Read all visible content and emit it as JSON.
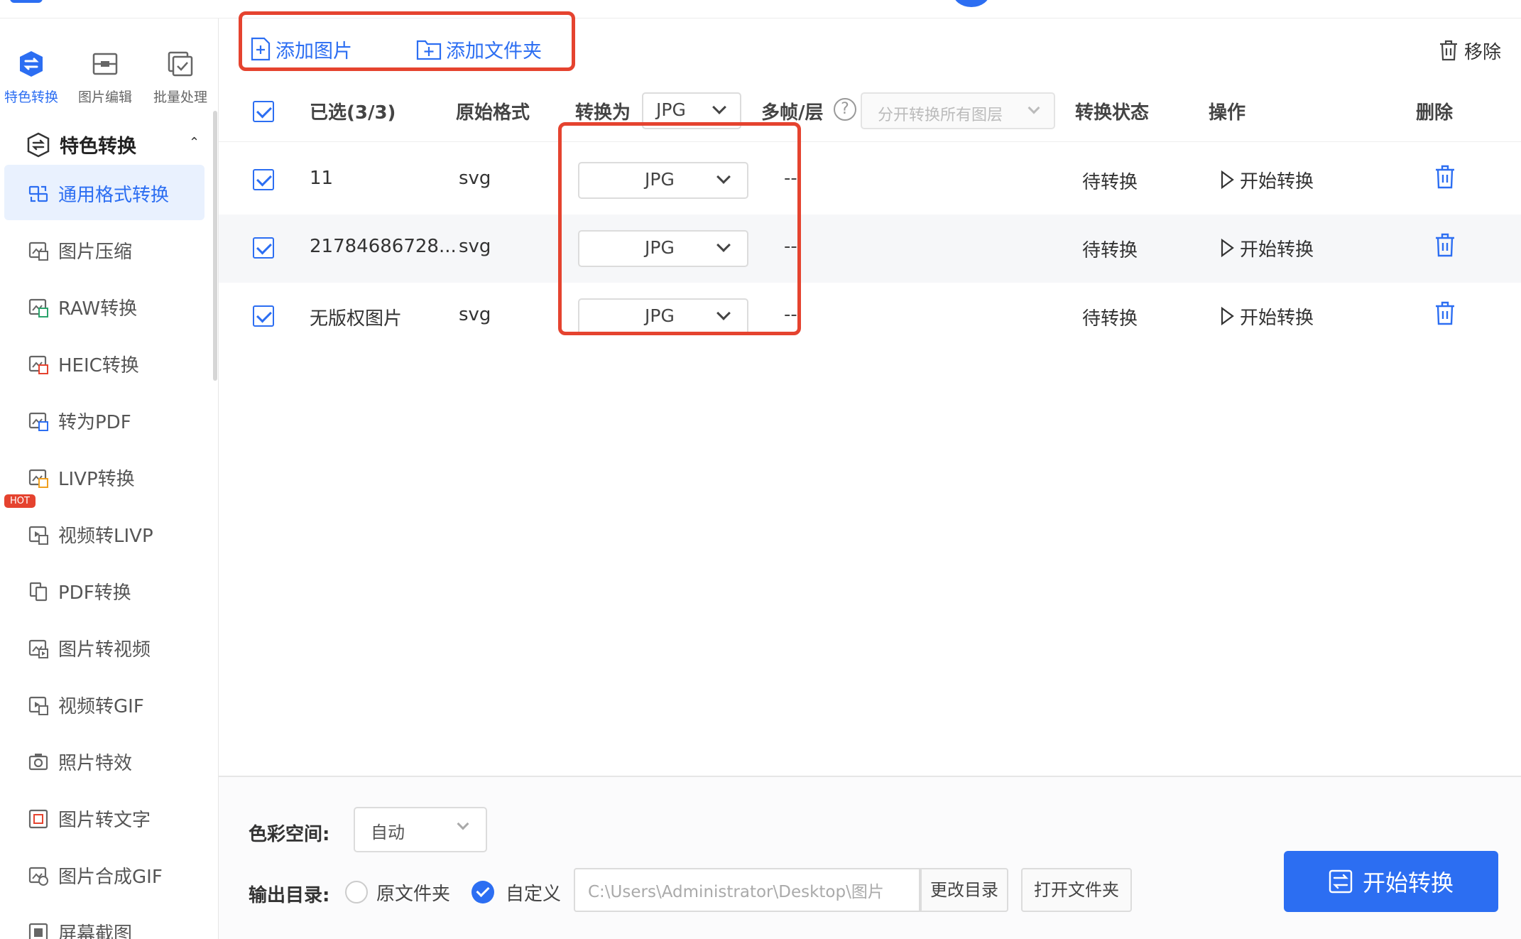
{
  "colors": {
    "accent": "#2c6ef2",
    "highlight_box": "#e5432f",
    "hot_badge": "#e5432f"
  },
  "sidebar": {
    "top_tabs": [
      {
        "label": "特色转换",
        "icon": "convert-shield-icon",
        "active": true
      },
      {
        "label": "图片编辑",
        "icon": "image-edit-icon",
        "active": false
      },
      {
        "label": "批量处理",
        "icon": "batch-check-icon",
        "active": false
      }
    ],
    "group_title": "特色转换",
    "items": [
      {
        "label": "通用格式转换",
        "active": true
      },
      {
        "label": "图片压缩"
      },
      {
        "label": "RAW转换"
      },
      {
        "label": "HEIC转换"
      },
      {
        "label": "转为PDF"
      },
      {
        "label": "LIVP转换"
      },
      {
        "label": "视频转LIVP",
        "badge": "HOT"
      },
      {
        "label": "PDF转换"
      },
      {
        "label": "图片转视频"
      },
      {
        "label": "视频转GIF"
      },
      {
        "label": "照片特效"
      },
      {
        "label": "图片转文字"
      },
      {
        "label": "图片合成GIF"
      },
      {
        "label": "屏幕截图"
      }
    ]
  },
  "toolbar": {
    "add_image": "添加图片",
    "add_folder": "添加文件夹",
    "remove": "移除"
  },
  "table": {
    "headers": {
      "selected": "已选(3/3)",
      "original_format": "原始格式",
      "convert_to": "转换为",
      "convert_to_value": "JPG",
      "multi_frame": "多帧/层",
      "help": "?",
      "layer_option": "分开转换所有图层",
      "status": "转换状态",
      "action": "操作",
      "delete": "删除"
    },
    "rows": [
      {
        "name": "11",
        "format": "svg",
        "target": "JPG",
        "frames": "--",
        "status": "待转换",
        "action": "开始转换"
      },
      {
        "name": "21784686728...",
        "format": "svg",
        "target": "JPG",
        "frames": "--",
        "status": "待转换",
        "action": "开始转换"
      },
      {
        "name": "无版权图片",
        "format": "svg",
        "target": "JPG",
        "frames": "--",
        "status": "待转换",
        "action": "开始转换"
      }
    ]
  },
  "footer": {
    "color_space_label": "色彩空间:",
    "color_space_value": "自动",
    "output_label": "输出目录:",
    "option_original": "原文件夹",
    "option_custom": "自定义",
    "selected_option": "自定义",
    "path": "C:\\Users\\Administrator\\Desktop\\图片",
    "change_dir": "更改目录",
    "open_folder": "打开文件夹",
    "start": "开始转换"
  }
}
